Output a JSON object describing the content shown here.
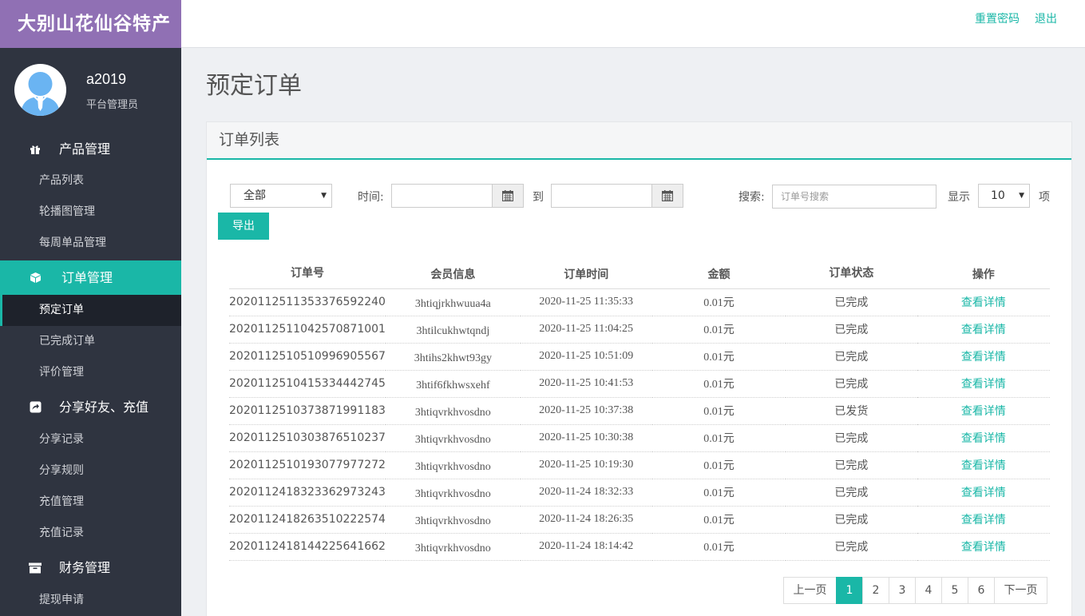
{
  "brand": "大别山花仙谷特产",
  "user": {
    "name": "a2019",
    "role": "平台管理员"
  },
  "header": {
    "reset_password": "重置密码",
    "logout": "退出"
  },
  "sidebar": {
    "sections": [
      {
        "label": "产品管理",
        "icon": "gift-icon",
        "items": [
          "产品列表",
          "轮播图管理",
          "每周单品管理"
        ]
      },
      {
        "label": "订单管理",
        "icon": "cube-icon",
        "active": true,
        "items": [
          "预定订单",
          "已完成订单",
          "评价管理"
        ]
      },
      {
        "label": "分享好友、充值",
        "icon": "share-icon",
        "items": [
          "分享记录",
          "分享规则",
          "充值管理",
          "充值记录"
        ]
      },
      {
        "label": "财务管理",
        "icon": "archive-icon",
        "items": [
          "提现申请"
        ]
      }
    ],
    "active_item": "预定订单"
  },
  "page": {
    "title": "预定订单",
    "panel_title": "订单列表"
  },
  "filters": {
    "status_value": "全部",
    "time_label": "时间:",
    "to_label": "到",
    "search_label": "搜索:",
    "search_placeholder": "订单号搜索",
    "show_label": "显示",
    "page_size": "10",
    "items_label": "项",
    "export_label": "导出"
  },
  "table": {
    "headers": [
      "订单号",
      "会员信息",
      "订单时间",
      "金额",
      "订单状态",
      "操作"
    ],
    "rows": [
      [
        "2020112511353376592240",
        "3htiqjrkhwuua4a",
        "2020-11-25 11:35:33",
        "0.01元",
        "已完成",
        "查看详情"
      ],
      [
        "2020112511042570871001",
        "3htilcukhwtqndj",
        "2020-11-25 11:04:25",
        "0.01元",
        "已完成",
        "查看详情"
      ],
      [
        "2020112510510996905567",
        "3htihs2khwt93gy",
        "2020-11-25 10:51:09",
        "0.01元",
        "已完成",
        "查看详情"
      ],
      [
        "2020112510415334442745",
        "3htif6fkhwsxehf",
        "2020-11-25 10:41:53",
        "0.01元",
        "已完成",
        "查看详情"
      ],
      [
        "2020112510373871991183",
        "3htiqvrkhvosdno",
        "2020-11-25 10:37:38",
        "0.01元",
        "已发货",
        "查看详情"
      ],
      [
        "2020112510303876510237",
        "3htiqvrkhvosdno",
        "2020-11-25 10:30:38",
        "0.01元",
        "已完成",
        "查看详情"
      ],
      [
        "2020112510193077977272",
        "3htiqvrkhvosdno",
        "2020-11-25 10:19:30",
        "0.01元",
        "已完成",
        "查看详情"
      ],
      [
        "2020112418323362973243",
        "3htiqvrkhvosdno",
        "2020-11-24 18:32:33",
        "0.01元",
        "已完成",
        "查看详情"
      ],
      [
        "2020112418263510222574",
        "3htiqvrkhvosdno",
        "2020-11-24 18:26:35",
        "0.01元",
        "已完成",
        "查看详情"
      ],
      [
        "2020112418144225641662",
        "3htiqvrkhvosdno",
        "2020-11-24 18:14:42",
        "0.01元",
        "已完成",
        "查看详情"
      ]
    ]
  },
  "pagination": {
    "prev": "上一页",
    "pages": [
      "1",
      "2",
      "3",
      "4",
      "5",
      "6"
    ],
    "current": "1",
    "next": "下一页"
  },
  "colors": {
    "accent": "#1ab7a7",
    "brand": "#9070b4",
    "sidebar": "#2f3440"
  }
}
